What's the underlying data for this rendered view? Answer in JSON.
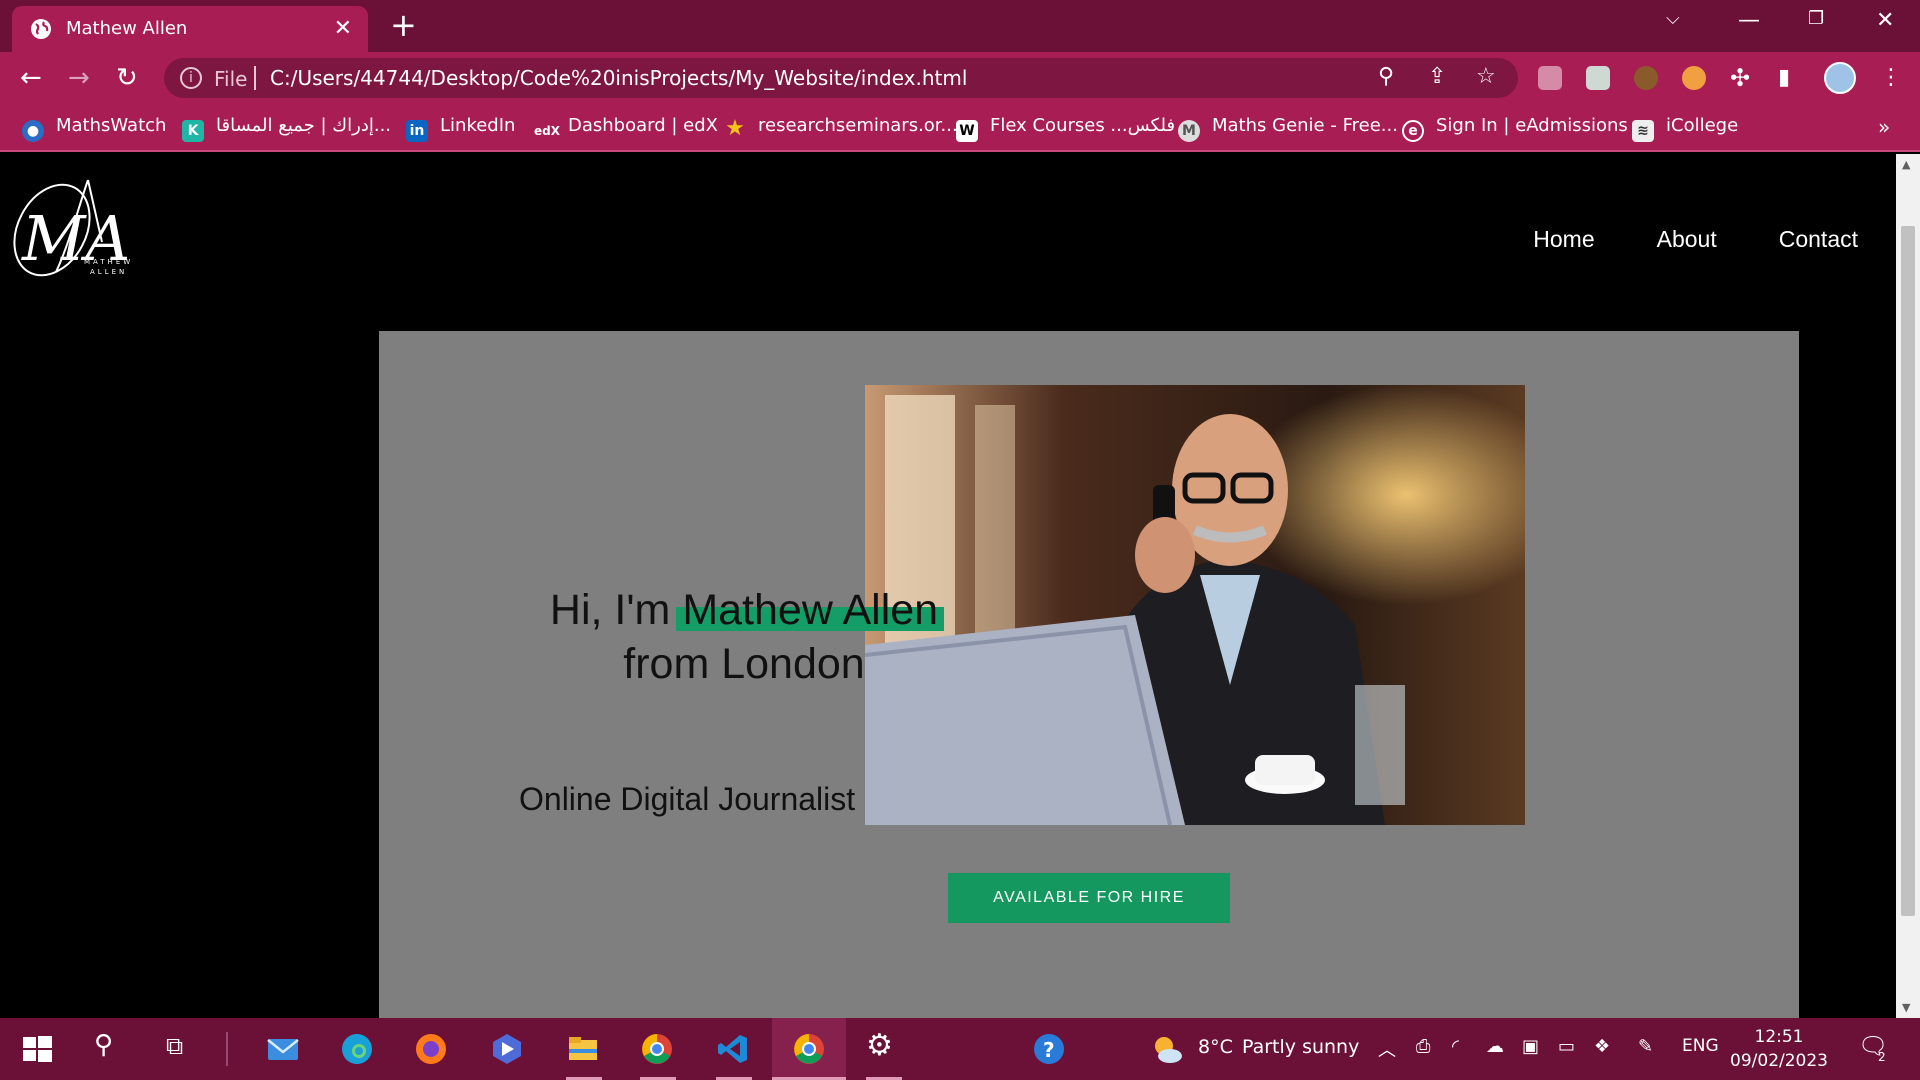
{
  "browser": {
    "tab_title": "Mathew Allen",
    "url_scheme": "File",
    "url": "C:/Users/44744/Desktop/Code%20inisProjects/My_Website/index.html",
    "bookmarks": [
      {
        "label": "MathsWatch",
        "icon": "mathswatch-icon"
      },
      {
        "label": "إدراك | جميع المساقا...",
        "icon": "edraak-icon"
      },
      {
        "label": "LinkedIn",
        "icon": "linkedin-icon"
      },
      {
        "label": "Dashboard | edX",
        "icon": "edx-icon"
      },
      {
        "label": "researchseminars.or...",
        "icon": "star-icon"
      },
      {
        "label": "Flex Courses ...فلكس",
        "icon": "w-icon"
      },
      {
        "label": "Maths Genie - Free...",
        "icon": "mathsgenie-icon"
      },
      {
        "label": "Sign In | eAdmissions",
        "icon": "eadmissions-icon"
      },
      {
        "label": "iCollege",
        "icon": "icollege-icon"
      }
    ]
  },
  "site": {
    "logo_text": "MATHEW ALLEN",
    "logo_monogram": "MA",
    "nav": [
      "Home",
      "About",
      "Contact"
    ],
    "hero": {
      "greeting": "Hi, I'm",
      "name": "Mathew Allen",
      "location": "from London",
      "role": "Online Digital Journalist",
      "cta": "AVAILABLE FOR HIRE"
    }
  },
  "taskbar": {
    "weather_temp": "8°C",
    "weather_text": "Partly sunny",
    "language": "ENG",
    "time": "12:51",
    "date": "09/02/2023",
    "notification_count": "2"
  },
  "colors": {
    "chrome_dark": "#6b1138",
    "chrome_light": "#a91d55",
    "hero_bg": "#7f7f7f",
    "accent_green": "#159d67"
  }
}
